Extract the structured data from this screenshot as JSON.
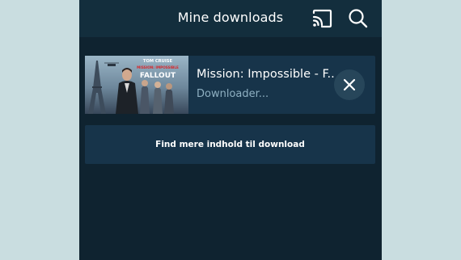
{
  "header": {
    "title": "Mine downloads",
    "cast_icon": "cast-icon",
    "search_icon": "search-icon"
  },
  "downloads": [
    {
      "title": "Mission: Impossible - F...",
      "status": "Downloader...",
      "poster": {
        "actor_credit": "TOM CRUISE",
        "movie_line1": "MISSION: IMPOSSIBLE",
        "movie_line2": "FALLOUT"
      },
      "cancel_icon": "close-icon"
    }
  ],
  "find_more": {
    "label": "Find mere indhold til download"
  },
  "colors": {
    "page_background": "#c9dde0",
    "app_background": "#0f2330",
    "header_background": "#132e3d",
    "card_background": "#17344a",
    "status_text": "#8fb0c2",
    "poster_accent": "#d8262b"
  }
}
